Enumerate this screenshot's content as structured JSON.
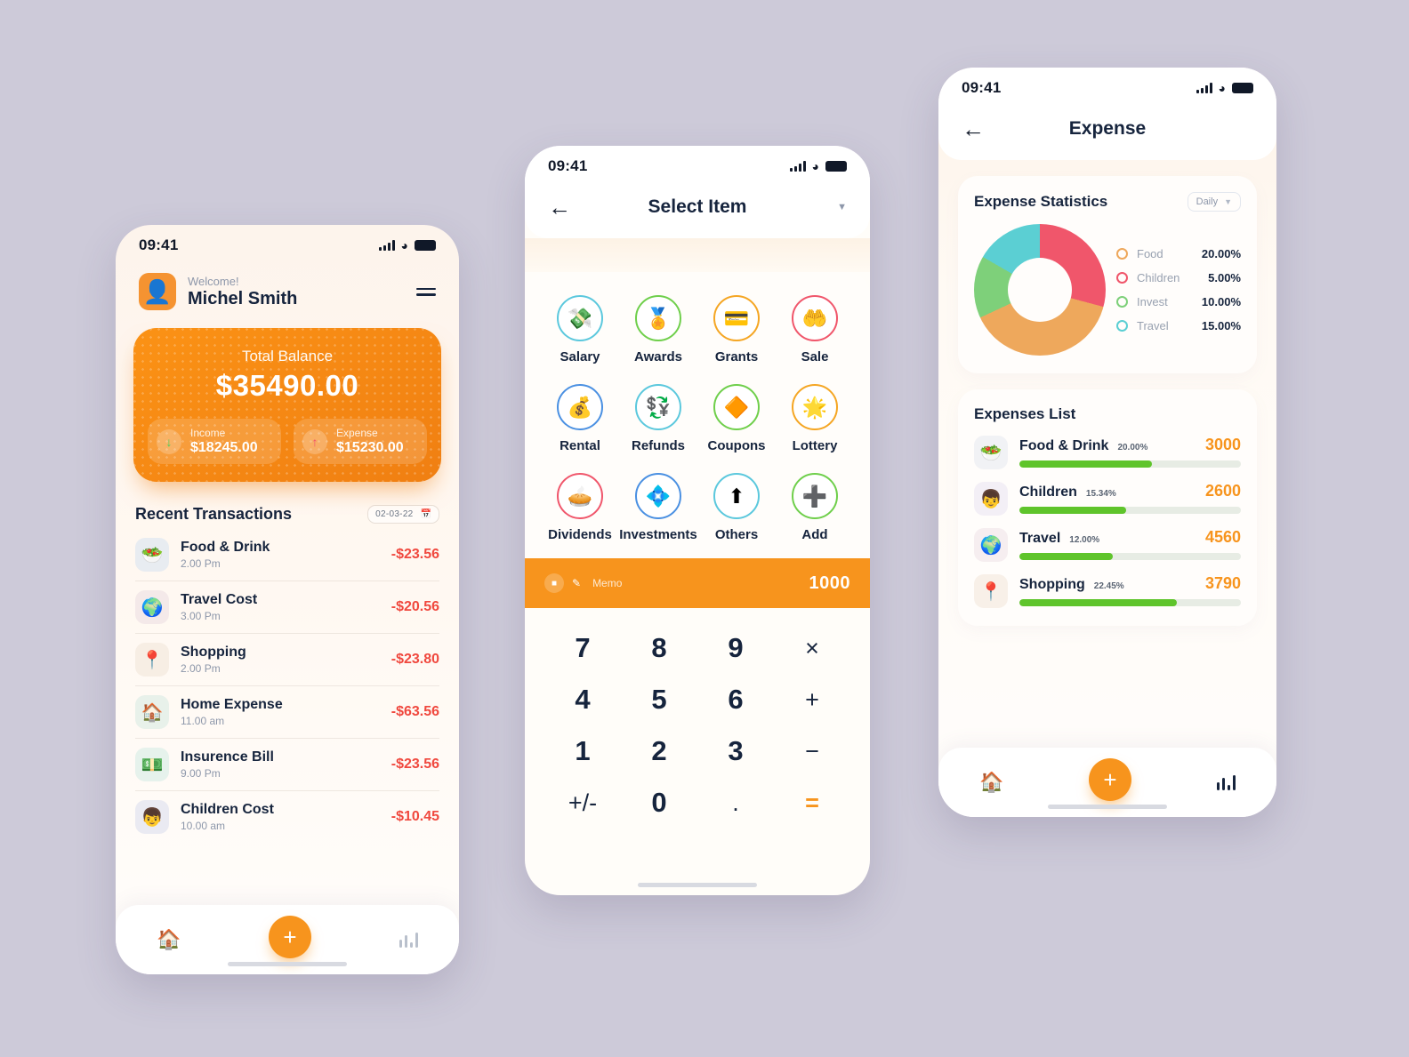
{
  "status_bar": {
    "time": "09:41"
  },
  "phone1": {
    "greeting": "Welcome!",
    "user_name": "Michel Smith",
    "avatar_icon": "person-avatar-icon",
    "menu_icon": "hamburger-menu-icon",
    "balance": {
      "label": "Total Balance",
      "amount": "$35490.00",
      "income_label": "Income",
      "income_amount": "$18245.00",
      "income_icon": "arrow-down-icon",
      "expense_label": "Expense",
      "expense_amount": "$15230.00",
      "expense_icon": "arrow-up-icon"
    },
    "transactions_title": "Recent Transactions",
    "date_chip": "02-03-22",
    "date_icon": "calendar-icon",
    "transactions": [
      {
        "name": "Food & Drink",
        "time": "2.00 Pm",
        "amount": "-$23.56",
        "icon": "salad-bowl-icon",
        "tint": "#e8ecf1"
      },
      {
        "name": "Travel Cost",
        "time": "3.00 Pm",
        "amount": "-$20.56",
        "icon": "globe-plane-icon",
        "tint": "#f4e9e9"
      },
      {
        "name": "Shopping",
        "time": "2.00 Pm",
        "amount": "-$23.80",
        "icon": "shopping-bag-icon",
        "tint": "#f7eee4"
      },
      {
        "name": "Home Expense",
        "time": "11.00 am",
        "amount": "-$63.56",
        "icon": "house-icon",
        "tint": "#e8f1ea"
      },
      {
        "name": "Insurence Bill",
        "time": "9.00 Pm",
        "amount": "-$23.56",
        "icon": "money-icon",
        "tint": "#e6f2ec"
      },
      {
        "name": "Children Cost",
        "time": "10.00 am",
        "amount": "-$10.45",
        "icon": "child-icon",
        "tint": "#eaeaf2"
      }
    ],
    "tabbar": {
      "home_icon": "home-icon",
      "add_icon": "plus-icon",
      "stats_icon": "bar-chart-icon"
    }
  },
  "phone2": {
    "title": "Select Item",
    "back_icon": "arrow-left-icon",
    "dropdown_icon": "chevron-down-icon",
    "categories": [
      {
        "label": "Salary",
        "icon": "money-envelope-icon",
        "ring": "#5bc8dd"
      },
      {
        "label": "Awards",
        "icon": "medal-icon",
        "ring": "#6fcf4b"
      },
      {
        "label": "Grants",
        "icon": "money-card-icon",
        "ring": "#f5a623"
      },
      {
        "label": "Sale",
        "icon": "hand-money-icon",
        "ring": "#f0566b"
      },
      {
        "label": "Rental",
        "icon": "money-bag-icon",
        "ring": "#4a90e2"
      },
      {
        "label": "Refunds",
        "icon": "refund-coin-icon",
        "ring": "#5bc8dd"
      },
      {
        "label": "Coupons",
        "icon": "coupon-icon",
        "ring": "#6fcf4b"
      },
      {
        "label": "Lottery",
        "icon": "lottery-star-icon",
        "ring": "#f5a623"
      },
      {
        "label": "Dividends",
        "icon": "pie-chart-icon",
        "ring": "#f0566b"
      },
      {
        "label": "Investments",
        "icon": "invest-coin-icon",
        "ring": "#4a90e2"
      },
      {
        "label": "Others",
        "icon": "growth-arrow-icon",
        "ring": "#5bc8dd"
      },
      {
        "label": "Add",
        "icon": "plus-square-icon",
        "ring": "#6fcf4b"
      }
    ],
    "memo": {
      "note_icon": "note-icon",
      "pen_icon": "pencil-icon",
      "placeholder": "Memo",
      "value": "1000"
    },
    "keypad": [
      "7",
      "8",
      "9",
      "×",
      "4",
      "5",
      "6",
      "+",
      "1",
      "2",
      "3",
      "−",
      "+/-",
      "0",
      ".",
      "="
    ]
  },
  "phone3": {
    "title": "Expense",
    "back_icon": "arrow-left-icon",
    "stats_title": "Expense Statistics",
    "period": "Daily",
    "period_icon": "chevron-down-icon",
    "list_title": "Expenses List",
    "expenses": [
      {
        "name": "Food & Drink",
        "percent": "20.00%",
        "value": "3000",
        "bar": 60,
        "icon": "salad-bowl-icon",
        "tint": "#f1f2f5"
      },
      {
        "name": "Children",
        "percent": "15.34%",
        "value": "2600",
        "bar": 48,
        "icon": "child-icon",
        "tint": "#f3eff6"
      },
      {
        "name": "Travel",
        "percent": "12.00%",
        "value": "4560",
        "bar": 42,
        "icon": "globe-plane-icon",
        "tint": "#f6eef0"
      },
      {
        "name": "Shopping",
        "percent": "22.45%",
        "value": "3790",
        "bar": 71,
        "icon": "shopping-bag-icon",
        "tint": "#f8f0e8"
      }
    ],
    "tabbar": {
      "home_icon": "home-icon",
      "add_icon": "plus-icon",
      "stats_icon": "bar-chart-icon"
    },
    "chart_data": {
      "type": "pie",
      "title": "Expense Statistics",
      "legend_position": "right",
      "categories": [
        "Food",
        "Children",
        "Invest",
        "Travel"
      ],
      "values": [
        20.0,
        5.0,
        10.0,
        15.0
      ],
      "labels": [
        "20.00%",
        "5.00%",
        "10.00%",
        "15.00%"
      ],
      "colors": [
        "#eea85c",
        "#f0566b",
        "#7ed07a",
        "#5bcfd3"
      ],
      "segment_degrees": [
        140,
        105,
        55,
        60
      ],
      "start_angle_deg": 0
    }
  }
}
